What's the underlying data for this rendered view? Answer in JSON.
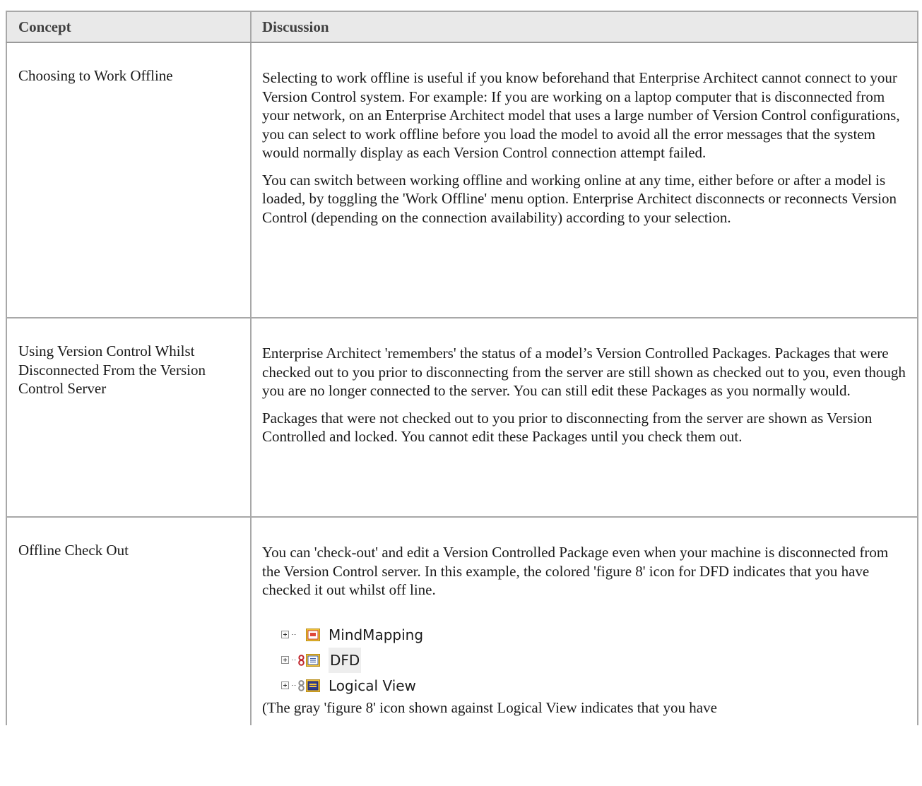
{
  "table": {
    "headers": {
      "concept": "Concept",
      "discussion": "Discussion"
    },
    "rows": [
      {
        "concept": "Choosing to Work Offline",
        "paragraphs": [
          "Selecting to work offline is useful if you know beforehand that Enterprise Architect cannot connect to your Version Control system. For example: If you are working on a laptop computer that is disconnected from your network, on an Enterprise Architect model that uses a large number of Version Control configurations, you can select to work offline before you load the model to avoid all the error messages that the system would normally display as each Version Control connection attempt failed.",
          "You can switch between working offline and working online at any time, either before or after a model is loaded, by toggling the 'Work Offline' menu option. Enterprise Architect disconnects or reconnects Version Control (depending on the connection availability) according to your selection."
        ]
      },
      {
        "concept": "Using Version Control Whilst Disconnected From the Version Control Server",
        "paragraphs": [
          "Enterprise Architect 'remembers' the status of a model’s Version Controlled Packages. Packages that were checked out to you prior to disconnecting from the server are still shown as checked out to you, even though you are no longer connected to the server. You can still edit these Packages as you normally would.",
          "Packages that were not checked out to you prior to disconnecting from the server are shown as Version Controlled and locked. You cannot edit these Packages until you check them out."
        ]
      },
      {
        "concept": "Offline Check Out",
        "paragraphs": [
          "You can 'check-out' and edit a Version Controlled Package even when your machine is disconnected from the Version Control server. In this example, the colored 'figure 8' icon for DFD indicates that you have checked it out whilst off line."
        ],
        "tree": [
          {
            "label": "MindMapping",
            "icon": "mindmap-package-icon",
            "vc": "none"
          },
          {
            "label": "DFD",
            "icon": "dfd-package-icon",
            "vc": "figure-8-colored-icon"
          },
          {
            "label": "Logical View",
            "icon": "logical-view-package-icon",
            "vc": "figure-8-gray-icon"
          }
        ],
        "trailing": "(The gray 'figure 8' icon shown against Logical View indicates that you have"
      }
    ]
  },
  "colors": {
    "header_bg": "#e9e9e9",
    "border": "#a8a8a8",
    "figure8_colored": "#c0272d",
    "figure8_gray": "#8c8c8c"
  }
}
